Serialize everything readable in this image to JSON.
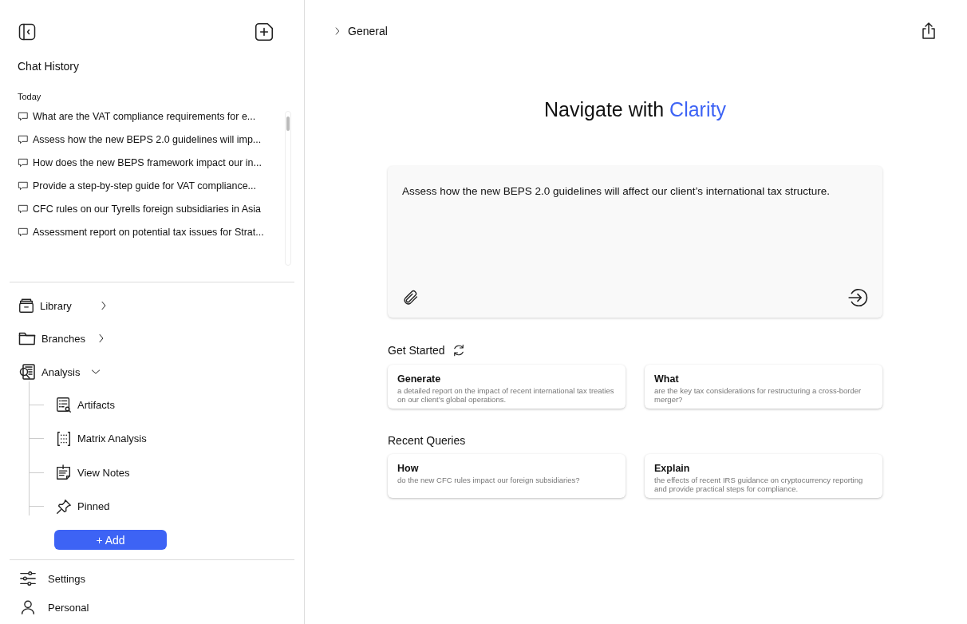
{
  "sidebar": {
    "title": "Chat History",
    "section": "Today",
    "chats": [
      "What are the VAT compliance requirements for e...",
      "Assess how the new BEPS 2.0 guidelines will imp...",
      "How does the new BEPS framework impact our in...",
      "Provide a step-by-step guide for VAT compliance...",
      "CFC rules on our Tyrells foreign subsidiaries in Asia",
      "Assessment report on potential tax issues for Strat..."
    ],
    "nav": [
      {
        "label": "Library",
        "expanded": false
      },
      {
        "label": "Branches",
        "expanded": false
      },
      {
        "label": "Analysis",
        "expanded": true,
        "children": [
          "Artifacts",
          "Matrix Analysis",
          "View Notes",
          "Pinned"
        ]
      }
    ],
    "add_button": "+ Add",
    "footer": [
      "Settings",
      "Personal"
    ]
  },
  "main": {
    "breadcrumb": "General",
    "headline": "Navigate with",
    "headline_accent": "Clarity",
    "prompt": {
      "value": "Assess how the new BEPS 2.0 guidelines will affect our client’s international tax structure."
    },
    "sections": [
      {
        "title": "Get Started",
        "refresh": true,
        "cards": [
          {
            "title": "Generate",
            "text": "a detailed report on the impact of recent international tax treaties on our client’s global operations."
          },
          {
            "title": "What",
            "text": "are the key tax considerations for restructuring a cross-border merger?"
          }
        ]
      },
      {
        "title": "Recent Queries",
        "refresh": false,
        "cards": [
          {
            "title": "How",
            "text": "do the new CFC rules impact our foreign subsidiaries?"
          },
          {
            "title": "Explain",
            "text": "the effects of recent IRS guidance on cryptocurrency reporting and provide practical steps for compliance."
          }
        ]
      }
    ]
  }
}
